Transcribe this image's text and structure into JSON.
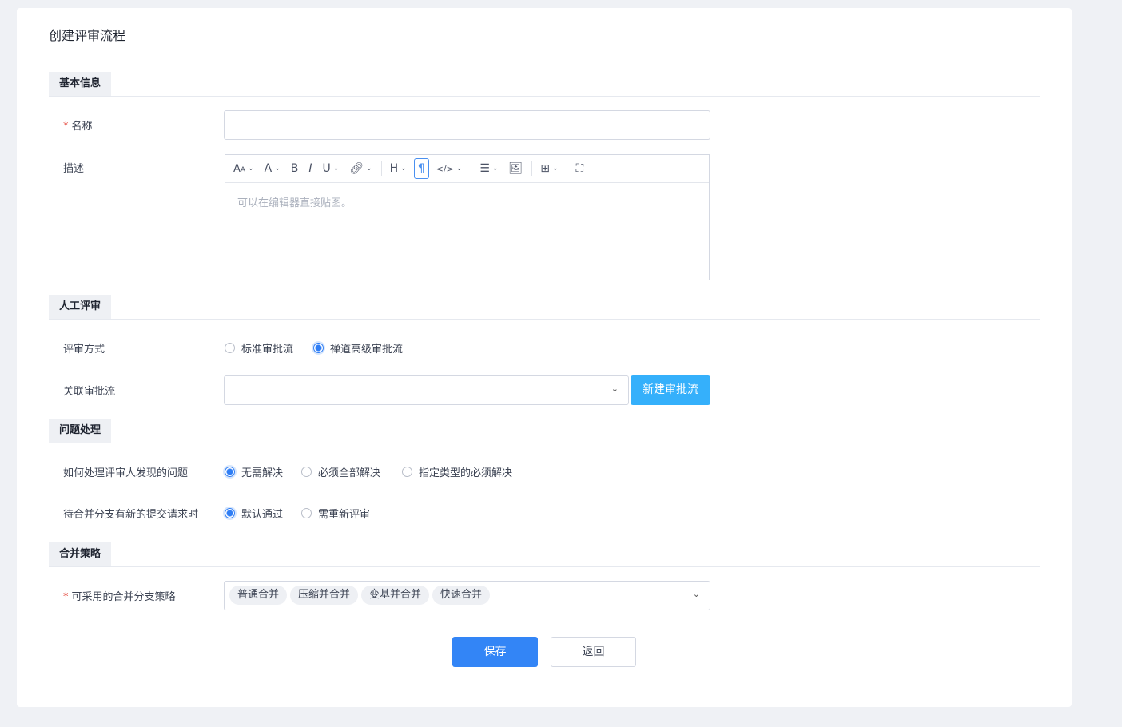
{
  "title": "创建评审流程",
  "sections": {
    "basic": "基本信息",
    "manual": "人工评审",
    "issues": "问题处理",
    "merge": "合并策略"
  },
  "fields": {
    "name_label": "名称",
    "name_value": "",
    "desc_label": "描述",
    "desc_placeholder": "可以在编辑器直接贴图。",
    "review_mode_label": "评审方式",
    "review_mode_options": [
      "标准审批流",
      "禅道高级审批流"
    ],
    "review_mode_selected": "禅道高级审批流",
    "flow_label": "关联审批流",
    "flow_value": "",
    "new_flow_button": "新建审批流",
    "issue_label": "如何处理评审人发现的问题",
    "issue_options": [
      "无需解决",
      "必须全部解决",
      "指定类型的必须解决"
    ],
    "issue_selected": "无需解决",
    "newcommit_label": "待合并分支有新的提交请求时",
    "newcommit_options": [
      "默认通过",
      "需重新评审"
    ],
    "newcommit_selected": "默认通过",
    "strategy_label": "可采用的合并分支策略",
    "strategy_tags": [
      "普通合并",
      "压缩并合并",
      "变基并合并",
      "快速合并"
    ]
  },
  "toolbar": [
    "font-size",
    "font-color",
    "bold",
    "italic",
    "underline",
    "link",
    "heading",
    "paragraph",
    "code",
    "list",
    "image",
    "table",
    "fullscreen"
  ],
  "buttons": {
    "save": "保存",
    "back": "返回"
  },
  "colors": {
    "primary": "#3385f6",
    "secondary_button": "#35b0fb",
    "required": "#e5453a"
  }
}
